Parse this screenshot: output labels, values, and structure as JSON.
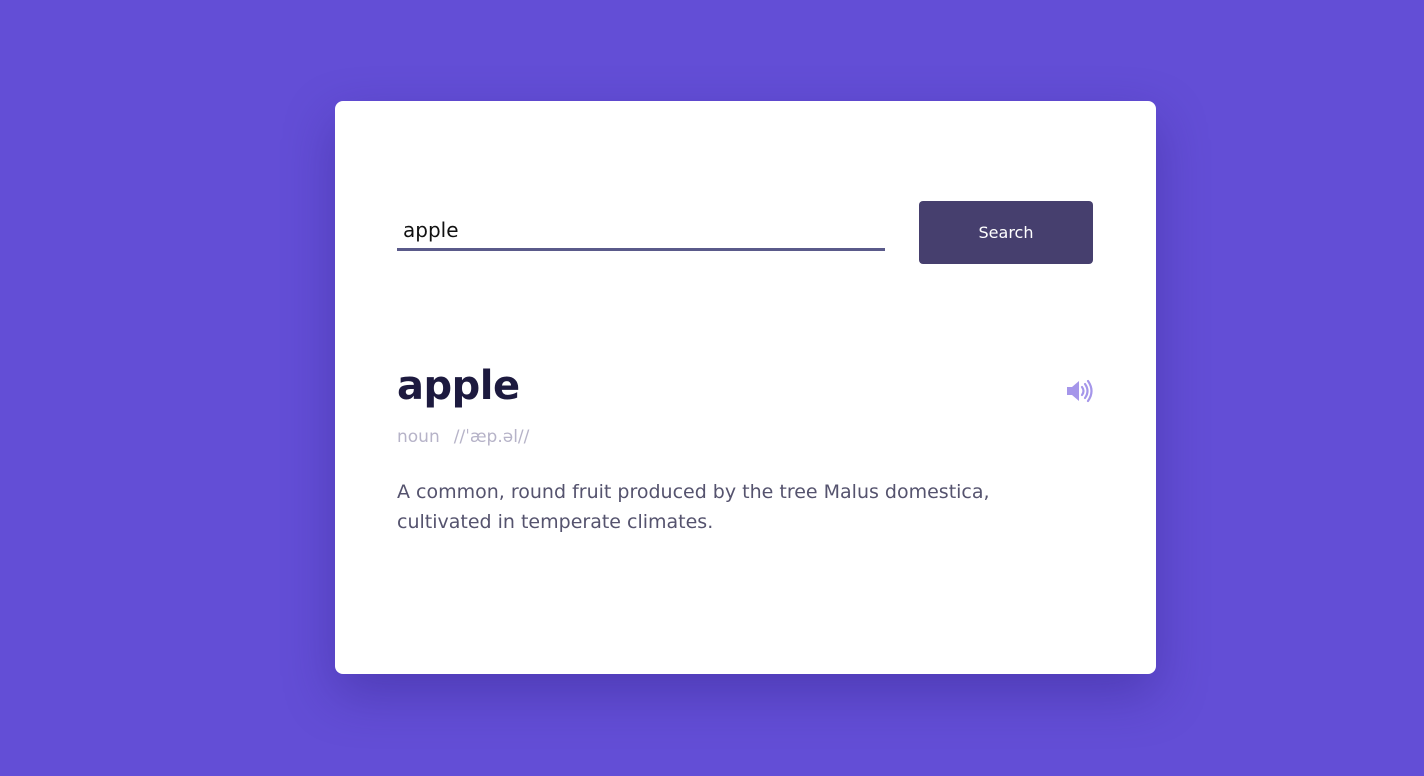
{
  "search": {
    "value": "apple",
    "button_label": "Search"
  },
  "result": {
    "word": "apple",
    "part_of_speech": "noun",
    "phonetic": "//ˈæp.əl//",
    "definition": "A common, round fruit produced by the tree Malus domestica, cultivated in temperate climates.",
    "audio_icon": "speaker-icon"
  },
  "colors": {
    "background": "#634ed6",
    "card": "#ffffff",
    "button": "#463f6e",
    "accent_icon": "#a596ea",
    "word": "#1d1a3f",
    "muted": "#b6b3c8",
    "definition": "#55536e"
  }
}
